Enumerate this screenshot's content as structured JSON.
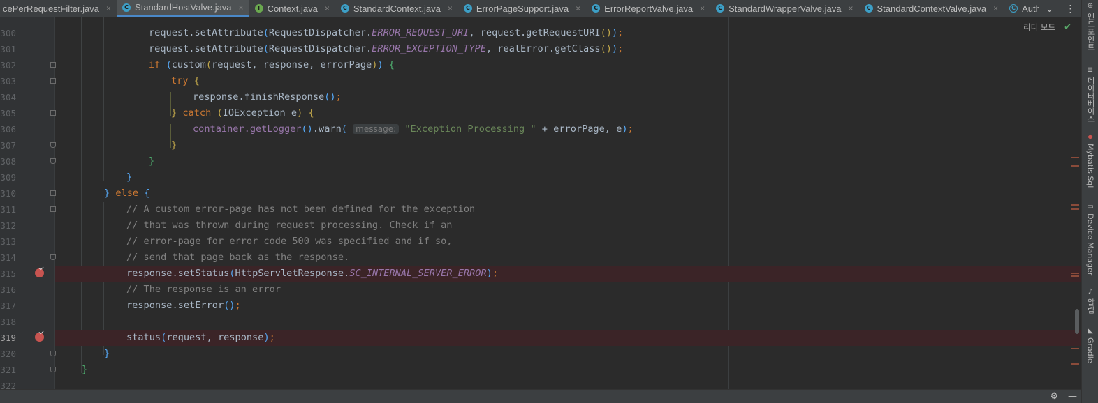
{
  "tabs": [
    {
      "label": "cePerRequestFilter.java",
      "icon": "class-icon",
      "active": false
    },
    {
      "label": "StandardHostValve.java",
      "icon": "class-icon",
      "active": true
    },
    {
      "label": "Context.java",
      "icon": "interface-icon",
      "active": false
    },
    {
      "label": "StandardContext.java",
      "icon": "class-icon",
      "active": false
    },
    {
      "label": "ErrorPageSupport.java",
      "icon": "class-icon",
      "active": false
    },
    {
      "label": "ErrorReportValve.java",
      "icon": "class-icon",
      "active": false
    },
    {
      "label": "StandardWrapperValve.java",
      "icon": "class-icon",
      "active": false
    },
    {
      "label": "StandardContextValve.java",
      "icon": "class-icon",
      "active": false
    },
    {
      "label": "AuthenticatorBase.java",
      "icon": "abstract-class-icon",
      "active": false
    }
  ],
  "tab_close_glyph": "×",
  "reader_mode": {
    "label": "리더 모드",
    "status_icon": "check-icon"
  },
  "right_tools": [
    {
      "label": "엔드포인트",
      "icon": "endpoints-icon"
    },
    {
      "label": "데이터베이스",
      "icon": "database-icon"
    },
    {
      "label": "Mybatis Sql",
      "icon": "mybatis-icon"
    },
    {
      "label": "Device Manager",
      "icon": "device-manager-icon"
    },
    {
      "label": "알림",
      "icon": "bell-icon"
    },
    {
      "label": "Gradle",
      "icon": "gradle-icon"
    }
  ],
  "lines": [
    {
      "num": "300",
      "bp": false
    },
    {
      "num": "301",
      "bp": false
    },
    {
      "num": "302",
      "bp": false
    },
    {
      "num": "303",
      "bp": false
    },
    {
      "num": "304",
      "bp": false
    },
    {
      "num": "305",
      "bp": false
    },
    {
      "num": "306",
      "bp": false
    },
    {
      "num": "307",
      "bp": false
    },
    {
      "num": "308",
      "bp": false
    },
    {
      "num": "309",
      "bp": false
    },
    {
      "num": "310",
      "bp": false
    },
    {
      "num": "311",
      "bp": false
    },
    {
      "num": "312",
      "bp": false
    },
    {
      "num": "313",
      "bp": false
    },
    {
      "num": "314",
      "bp": false
    },
    {
      "num": "315",
      "bp": true
    },
    {
      "num": "316",
      "bp": false
    },
    {
      "num": "317",
      "bp": false
    },
    {
      "num": "318",
      "bp": false
    },
    {
      "num": "319",
      "bp": true
    },
    {
      "num": "320",
      "bp": false
    },
    {
      "num": "321",
      "bp": false
    },
    {
      "num": "322",
      "bp": false
    }
  ],
  "code": {
    "l300": {
      "a": "request.setAttribute",
      "b": "(",
      "c": "RequestDispatcher.",
      "d": "ERROR_REQUEST_URI",
      "e": ", request.getRequestURI",
      "f": "()",
      "g": ")",
      "h": ";"
    },
    "l301": {
      "a": "request.setAttribute",
      "b": "(",
      "c": "RequestDispatcher.",
      "d": "ERROR_EXCEPTION_TYPE",
      "e": ", realError.getClass",
      "f": "()",
      "g": ")",
      "h": ";"
    },
    "l302": {
      "kw": "if ",
      "a": "(",
      "b": "custom",
      "c": "(",
      "d": "request, response, errorPage",
      "e": ")",
      "f": ")",
      "g": " {"
    },
    "l303": {
      "kw": "try ",
      "a": "{"
    },
    "l304": {
      "a": "response.finishResponse",
      "b": "()",
      "c": ";"
    },
    "l305": {
      "a": "} ",
      "kw": "catch ",
      "b": "(",
      "c": "IOException e",
      "d": ")",
      "e": " {"
    },
    "l306": {
      "a": "container.getLogger",
      "b": "()",
      "c": ".warn",
      "d": "(",
      "hint": "message:",
      "str": "\"Exception Processing \"",
      "e": " + errorPage, e",
      "f": ")",
      "g": ";"
    },
    "l307": {
      "a": "}"
    },
    "l308": {
      "a": "}"
    },
    "l309": {
      "a": "}"
    },
    "l310": {
      "a": "} ",
      "kw": "else ",
      "b": "{"
    },
    "l311": {
      "cm": "// A custom error-page has not been defined for the exception"
    },
    "l312": {
      "cm": "// that was thrown during request processing. Check if an"
    },
    "l313": {
      "cm": "// error-page for error code 500 was specified and if so,"
    },
    "l314": {
      "cm": "// send that page back as the response."
    },
    "l315": {
      "a": "response.setStatus",
      "b": "(",
      "c": "HttpServletResponse.",
      "d": "SC_INTERNAL_SERVER_ERROR",
      "e": ")",
      "f": ";"
    },
    "l316": {
      "cm": "// The response is an error"
    },
    "l317": {
      "a": "response.setError",
      "b": "()",
      "c": ";"
    },
    "l319": {
      "a": "status",
      "b": "(",
      "c": "request, response",
      "d": ")",
      "e": ";"
    },
    "l320": {
      "a": "}"
    },
    "l321": {
      "a": "}"
    }
  },
  "status_icons": [
    "gear-icon",
    "minimize-icon"
  ]
}
